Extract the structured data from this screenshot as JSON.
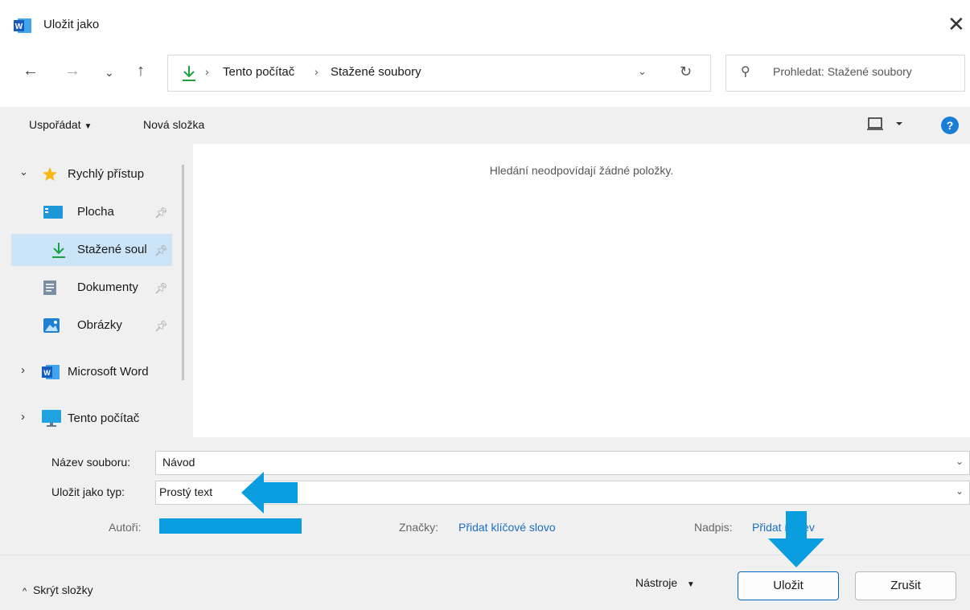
{
  "window": {
    "title": "Uložit jako",
    "app_icon": "word-icon"
  },
  "nav": {
    "back": "←",
    "forward": "→",
    "recent": "⌄",
    "up": "↑",
    "path": [
      "Tento počítač",
      "Stažené soubory"
    ],
    "search_placeholder": "Prohledat: Stažené soubory"
  },
  "toolbar": {
    "organize": "Uspořádat",
    "new_folder": "Nová složka"
  },
  "tree": [
    {
      "label": "Rychlý přístup",
      "icon": "star-icon"
    },
    {
      "label": "Plocha",
      "icon": "desktop-icon"
    },
    {
      "label": "Stažené soul",
      "icon": "download-icon"
    },
    {
      "label": "Dokumenty",
      "icon": "documents-icon"
    },
    {
      "label": "Obrázky",
      "icon": "pictures-icon"
    },
    {
      "label": "Microsoft Word",
      "icon": "word-icon"
    },
    {
      "label": "Tento počítač",
      "icon": "computer-icon"
    }
  ],
  "content": {
    "empty_message": "Hledání neodpovídají žádné položky."
  },
  "form": {
    "filename_label": "Název souboru:",
    "filename_value": "Návod",
    "type_label": "Uložit jako typ:",
    "type_value": "Prostý text",
    "authors_label": "Autoři:",
    "tags_label": "Značky:",
    "tags_link": "Přidat klíčové slovo",
    "title_label": "Nadpis:",
    "title_link": "Přidat název"
  },
  "footer": {
    "hide_folders": "Skrýt složky",
    "tools": "Nástroje",
    "save": "Uložit",
    "cancel": "Zrušit"
  },
  "colors": {
    "accent": "#0a84c4",
    "annotation_arrow": "#0a9ee0",
    "link": "#1a6fc4"
  }
}
